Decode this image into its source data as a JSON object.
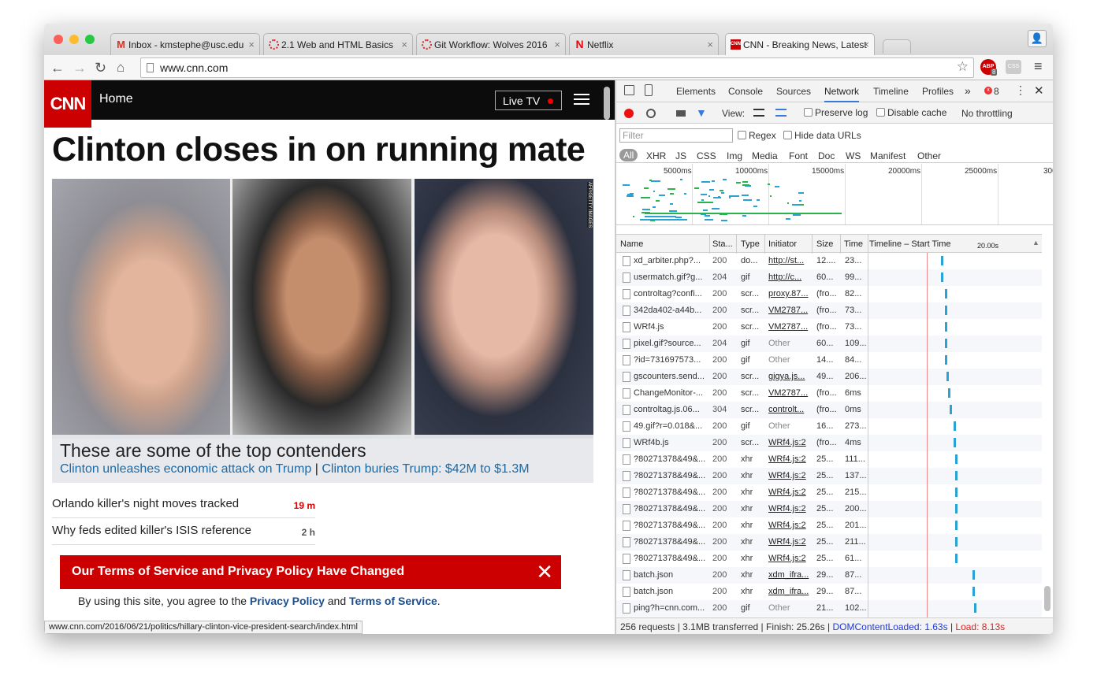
{
  "browser": {
    "tabs": [
      {
        "label": "Inbox - kmstephe@usc.edu",
        "icon": "gmail-icon"
      },
      {
        "label": "2.1 Web and HTML Basics",
        "icon": "loading-icon"
      },
      {
        "label": "Git Workflow: Wolves 2016",
        "icon": "loading-icon"
      },
      {
        "label": "Netflix",
        "icon": "netflix-icon"
      },
      {
        "label": "CNN - Breaking News, Latest",
        "icon": "cnn-icon"
      }
    ],
    "url": "www.cnn.com",
    "extension_badge": "8"
  },
  "cnn": {
    "logo": "CNN",
    "home": "Home",
    "live_tv": "Live TV",
    "headline": "Clinton closes in on running mate",
    "photo_credit": "AFP/GETTY IMAGES",
    "caption_title": "These are some of the top contenders",
    "caption_link1": "Clinton unleashes economic attack on Trump",
    "caption_sep": "|",
    "caption_link2": "Clinton buries Trump: $42M to $1.3M",
    "stories": [
      {
        "title": "Orlando killer's night moves tracked",
        "time": "19 m"
      },
      {
        "title": "Why feds edited killer's ISIS reference",
        "time": "2 h"
      }
    ],
    "tos_title": "Our Terms of Service and Privacy Policy Have Changed",
    "tos_body_pre": "By using this site, you agree to the",
    "tos_privacy": "Privacy Policy",
    "tos_and": "and",
    "tos_terms": "Terms of Service",
    "tos_end": ".",
    "status_url": "www.cnn.com/2016/06/21/politics/hillary-clinton-vice-president-search/index.html"
  },
  "devtools": {
    "tabs": [
      "Elements",
      "Console",
      "Sources",
      "Network",
      "Timeline",
      "Profiles"
    ],
    "more": "»",
    "error_count": "8",
    "view_label": "View:",
    "preserve_log": "Preserve log",
    "disable_cache": "Disable cache",
    "throttling": "No throttling",
    "filter_placeholder": "Filter",
    "regex": "Regex",
    "hide_data_urls": "Hide data URLs",
    "types": [
      "All",
      "XHR",
      "JS",
      "CSS",
      "Img",
      "Media",
      "Font",
      "Doc",
      "WS",
      "Manifest",
      "Other"
    ],
    "overview_ticks": [
      "5000ms",
      "10000ms",
      "15000ms",
      "20000ms",
      "25000ms",
      "300"
    ],
    "columns": [
      "Name",
      "Sta...",
      "Type",
      "Initiator",
      "Size",
      "Time",
      "Timeline – Start Time",
      "20.00s"
    ],
    "rows": [
      {
        "name": "xd_arbiter.php?...",
        "status": "200",
        "type": "do...",
        "initiator": "http://st...",
        "size": "12....",
        "time": "23...",
        "link": true,
        "wf": 0.42
      },
      {
        "name": "usermatch.gif?g...",
        "status": "204",
        "type": "gif",
        "initiator": "http://c...",
        "size": "60...",
        "time": "99...",
        "link": true,
        "wf": 0.42
      },
      {
        "name": "controltag?confi...",
        "status": "200",
        "type": "scr...",
        "initiator": "proxy.87...",
        "size": "(fro...",
        "time": "82...",
        "link": true,
        "wf": 0.44
      },
      {
        "name": "342da402-a44b...",
        "status": "200",
        "type": "scr...",
        "initiator": "VM2787...",
        "size": "(fro...",
        "time": "73...",
        "link": true,
        "wf": 0.44
      },
      {
        "name": "WRf4.js",
        "status": "200",
        "type": "scr...",
        "initiator": "VM2787...",
        "size": "(fro...",
        "time": "73...",
        "link": true,
        "wf": 0.44
      },
      {
        "name": "pixel.gif?source...",
        "status": "204",
        "type": "gif",
        "initiator": "Other",
        "size": "60...",
        "time": "109...",
        "link": false,
        "wf": 0.44
      },
      {
        "name": "?id=731697573...",
        "status": "200",
        "type": "gif",
        "initiator": "Other",
        "size": "14...",
        "time": "84...",
        "link": false,
        "wf": 0.44
      },
      {
        "name": "gscounters.send...",
        "status": "200",
        "type": "scr...",
        "initiator": "gigya.js...",
        "size": "49...",
        "time": "206...",
        "link": true,
        "wf": 0.45
      },
      {
        "name": "ChangeMonitor-...",
        "status": "200",
        "type": "scr...",
        "initiator": "VM2787...",
        "size": "(fro...",
        "time": "6ms",
        "link": true,
        "wf": 0.46
      },
      {
        "name": "controltag.js.06...",
        "status": "304",
        "type": "scr...",
        "initiator": "controlt...",
        "size": "(fro...",
        "time": "0ms",
        "link": true,
        "wf": 0.47
      },
      {
        "name": "49.gif?r=0.018&...",
        "status": "200",
        "type": "gif",
        "initiator": "Other",
        "size": "16...",
        "time": "273...",
        "link": false,
        "wf": 0.49
      },
      {
        "name": "WRf4b.js",
        "status": "200",
        "type": "scr...",
        "initiator": "WRf4.js:2",
        "size": "(fro...",
        "time": "4ms",
        "link": true,
        "wf": 0.49
      },
      {
        "name": "?80271378&49&...",
        "status": "200",
        "type": "xhr",
        "initiator": "WRf4.js:2",
        "size": "25...",
        "time": "111...",
        "link": true,
        "wf": 0.5
      },
      {
        "name": "?80271378&49&...",
        "status": "200",
        "type": "xhr",
        "initiator": "WRf4.js:2",
        "size": "25...",
        "time": "137...",
        "link": true,
        "wf": 0.5
      },
      {
        "name": "?80271378&49&...",
        "status": "200",
        "type": "xhr",
        "initiator": "WRf4.js:2",
        "size": "25...",
        "time": "215...",
        "link": true,
        "wf": 0.5
      },
      {
        "name": "?80271378&49&...",
        "status": "200",
        "type": "xhr",
        "initiator": "WRf4.js:2",
        "size": "25...",
        "time": "200...",
        "link": true,
        "wf": 0.5
      },
      {
        "name": "?80271378&49&...",
        "status": "200",
        "type": "xhr",
        "initiator": "WRf4.js:2",
        "size": "25...",
        "time": "201...",
        "link": true,
        "wf": 0.5
      },
      {
        "name": "?80271378&49&...",
        "status": "200",
        "type": "xhr",
        "initiator": "WRf4.js:2",
        "size": "25...",
        "time": "211...",
        "link": true,
        "wf": 0.5
      },
      {
        "name": "?80271378&49&...",
        "status": "200",
        "type": "xhr",
        "initiator": "WRf4.js:2",
        "size": "25...",
        "time": "61...",
        "link": true,
        "wf": 0.5
      },
      {
        "name": "batch.json",
        "status": "200",
        "type": "xhr",
        "initiator": "xdm_ifra...",
        "size": "29...",
        "time": "87...",
        "link": true,
        "wf": 0.6
      },
      {
        "name": "batch.json",
        "status": "200",
        "type": "xhr",
        "initiator": "xdm_ifra...",
        "size": "29...",
        "time": "87...",
        "link": true,
        "wf": 0.6
      },
      {
        "name": "ping?h=cnn.com...",
        "status": "200",
        "type": "gif",
        "initiator": "Other",
        "size": "21...",
        "time": "102...",
        "link": false,
        "wf": 0.61
      }
    ],
    "summary_pre": "256 requests | 3.1MB transferred | Finish: 25.26s |",
    "dom_loaded": "DOMContentLoaded: 1.63s",
    "summary_sep": "|",
    "load": "Load: 8.13s"
  }
}
